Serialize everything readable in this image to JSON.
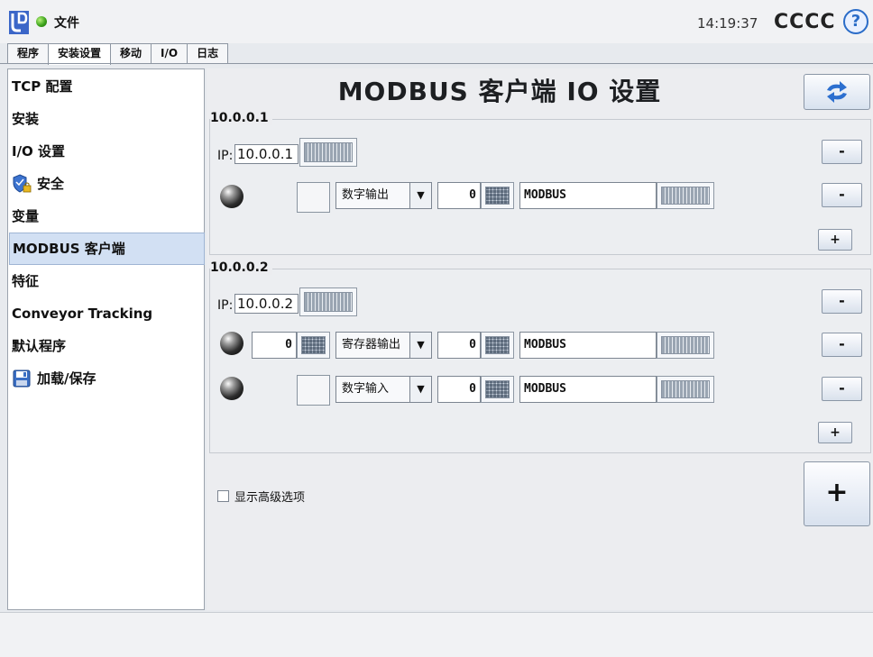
{
  "header": {
    "file_label": "文件",
    "clock": "14:19:37",
    "robot_name": "CCCC",
    "help_glyph": "?"
  },
  "tabs": [
    {
      "label": "程序",
      "active": false
    },
    {
      "label": "安装设置",
      "active": true
    },
    {
      "label": "移动",
      "active": false
    },
    {
      "label": "I/O",
      "active": false
    },
    {
      "label": "日志",
      "active": false
    }
  ],
  "sidebar": {
    "items": [
      {
        "label": "TCP 配置"
      },
      {
        "label": "安装"
      },
      {
        "label": "I/O 设置"
      },
      {
        "label": "安全"
      },
      {
        "label": "变量"
      },
      {
        "label": "MODBUS 客户端",
        "selected": true
      },
      {
        "label": "特征"
      },
      {
        "label": "Conveyor Tracking"
      },
      {
        "label": "默认程序"
      },
      {
        "label": "加载/保存"
      }
    ]
  },
  "main": {
    "title": "MODBUS 客户端 IO 设置",
    "groups": [
      {
        "title": "10.0.0.1",
        "ip_label": "IP:",
        "ip": "10.0.0.1",
        "signals": [
          {
            "address": "",
            "type": "数字输出",
            "number": "0",
            "name": "MODBUS"
          }
        ]
      },
      {
        "title": "10.0.0.2",
        "ip_label": "IP:",
        "ip": "10.0.0.2",
        "signals": [
          {
            "address": "0",
            "type": "寄存器输出",
            "number": "0",
            "name": "MODBUS"
          },
          {
            "address": "",
            "type": "数字输入",
            "number": "0",
            "name": "MODBUS"
          }
        ]
      }
    ],
    "minus_label": "-",
    "plus_label": "+",
    "advanced_label": "显示高级选项",
    "add_label": "+"
  },
  "colors": {
    "selected_bg": "#d2e0f3",
    "help_blue": "#2a6cc8",
    "status_green": "#3da31c"
  }
}
